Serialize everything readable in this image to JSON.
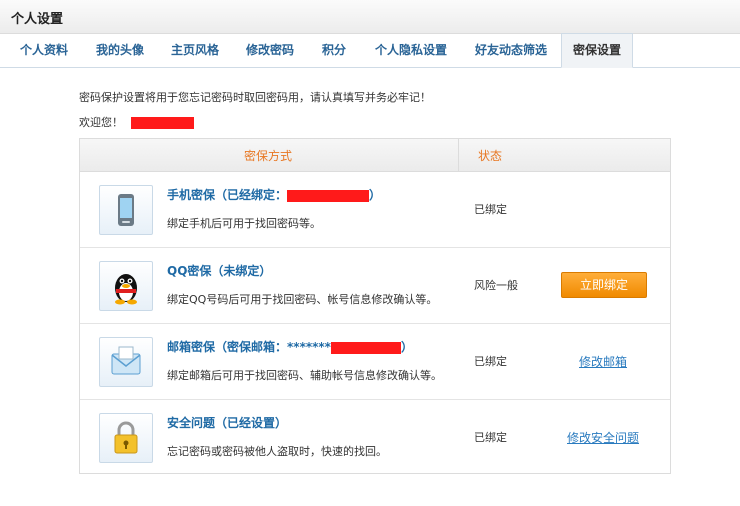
{
  "page": {
    "title": "个人设置"
  },
  "tabs": [
    {
      "label": "个人资料"
    },
    {
      "label": "我的头像"
    },
    {
      "label": "主页风格"
    },
    {
      "label": "修改密码"
    },
    {
      "label": "积分"
    },
    {
      "label": "个人隐私设置"
    },
    {
      "label": "好友动态筛选"
    },
    {
      "label": "密保设置",
      "active": true
    }
  ],
  "intro": "密码保护设置将用于您忘记密码时取回密码用，请认真填写并务必牢记！",
  "welcome": "欢迎您！",
  "table": {
    "headers": {
      "method": "密保方式",
      "status": "状态"
    },
    "rows": [
      {
        "icon": "phone-icon",
        "title_prefix": "手机密保（已经绑定：",
        "title_suffix": "）",
        "desc": "绑定手机后可用于找回密码等。",
        "status": "已绑定",
        "action": ""
      },
      {
        "icon": "qq-penguin-icon",
        "title": "QQ密保（未绑定）",
        "desc": "绑定QQ号码后可用于找回密码、帐号信息修改确认等。",
        "status": "风险一般",
        "action": "立即绑定"
      },
      {
        "icon": "mail-icon",
        "title_prefix": "邮箱密保（密保邮箱：",
        "title_mask": "*******",
        "title_suffix": "）",
        "desc": "绑定邮箱后可用于找回密码、辅助帐号信息修改确认等。",
        "status": "已绑定",
        "action": "修改邮箱"
      },
      {
        "icon": "lock-icon",
        "title": "安全问题（已经设置）",
        "desc": "忘记密码或密码被他人盗取时，快速的找回。",
        "status": "已绑定",
        "action": "修改安全问题"
      }
    ]
  },
  "colors": {
    "accent": "#e87722",
    "link": "#2a7bbf",
    "title": "#1f6aa5",
    "button": "#f08a00",
    "redaction": "#ff1a1a"
  }
}
